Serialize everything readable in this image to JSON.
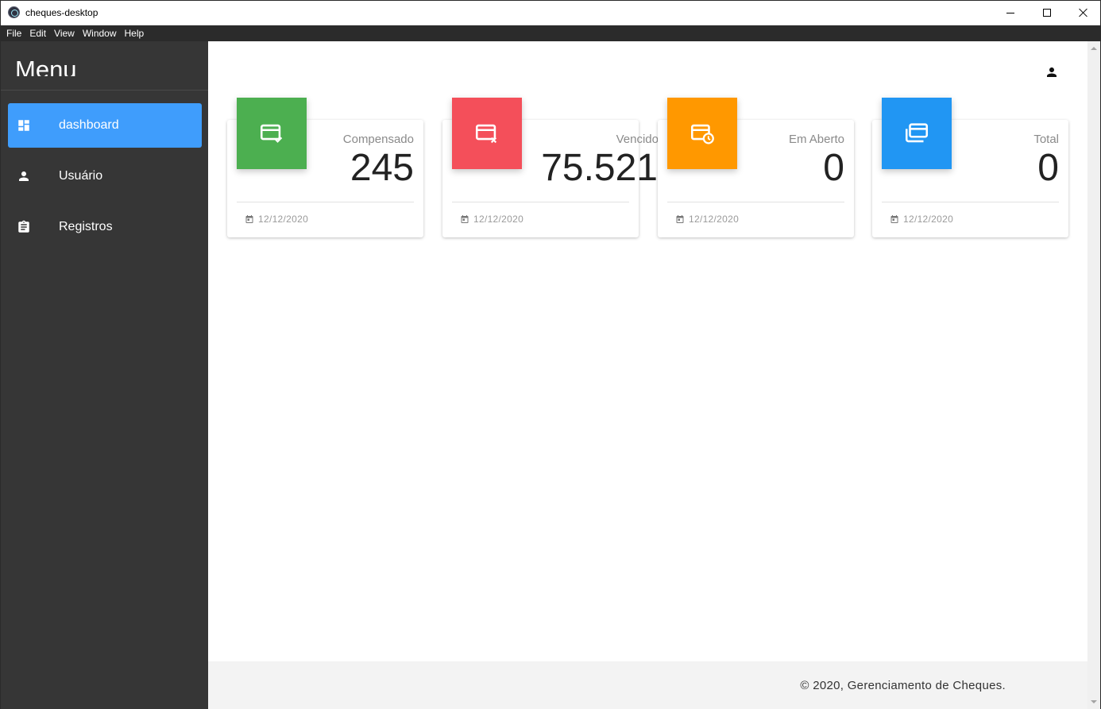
{
  "window": {
    "title": "cheques-desktop"
  },
  "menubar": {
    "items": [
      "File",
      "Edit",
      "View",
      "Window",
      "Help"
    ]
  },
  "sidebar": {
    "title": "Menu",
    "items": [
      {
        "label": "dashboard",
        "icon": "dashboard-icon",
        "active": true
      },
      {
        "label": "Usuário",
        "icon": "person-icon",
        "active": false
      },
      {
        "label": "Registros",
        "icon": "clipboard-icon",
        "active": false
      }
    ]
  },
  "header": {
    "user_icon": "account-icon"
  },
  "cards": [
    {
      "label": "Compensado",
      "value": "245",
      "date": "12/12/2020",
      "color": "#4caf50",
      "icon": "card-check-icon"
    },
    {
      "label": "Vencido",
      "value": "75.521",
      "date": "12/12/2020",
      "color": "#f44f5a",
      "icon": "card-remove-icon"
    },
    {
      "label": "Em Aberto",
      "value": "0",
      "date": "12/12/2020",
      "color": "#ff9800",
      "icon": "card-clock-icon"
    },
    {
      "label": "Total",
      "value": "0",
      "date": "12/12/2020",
      "color": "#2196f3",
      "icon": "cards-stack-icon"
    }
  ],
  "footer": {
    "text": "© 2020, Gerenciamento de Cheques."
  },
  "colors": {
    "sidebar_bg": "#363636",
    "active_nav": "#3f9dfc",
    "menubar_bg": "#2b2b2b",
    "footer_bg": "#f3f3f3"
  }
}
